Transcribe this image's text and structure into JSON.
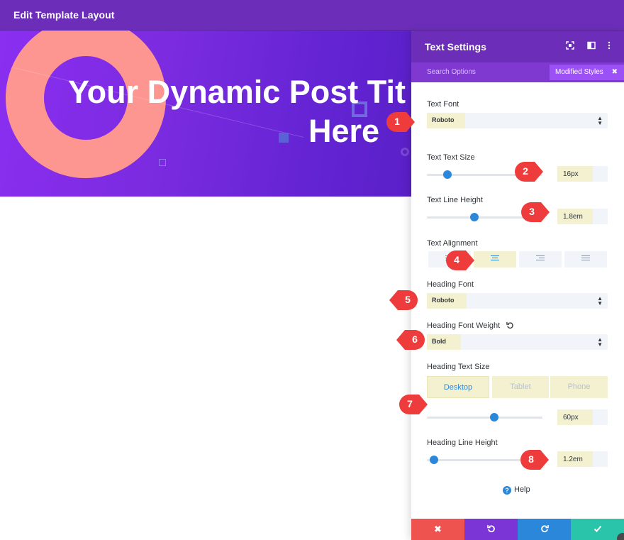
{
  "topbar": {
    "title": "Edit Template Layout"
  },
  "hero": {
    "title_line1": "Your Dynamic Post Tit",
    "title_line2": "Here"
  },
  "panel": {
    "title": "Text Settings",
    "header_icons": [
      "expand-icon",
      "sidebar-icon",
      "more-icon"
    ],
    "search_placeholder": "Search Options",
    "modified_label": "Modified Styles",
    "text_font": {
      "label": "Text Font",
      "value": "Roboto"
    },
    "text_size": {
      "label": "Text Text Size",
      "value": "16px",
      "level": 0.18
    },
    "text_line_height": {
      "label": "Text Line Height",
      "value": "1.8em",
      "level": 0.41
    },
    "text_alignment": {
      "label": "Text Alignment",
      "options": [
        "left",
        "center",
        "right",
        "justify"
      ],
      "selected": "center"
    },
    "heading_font": {
      "label": "Heading Font",
      "value": "Roboto"
    },
    "heading_font_weight": {
      "label": "Heading Font Weight",
      "value": "Bold"
    },
    "heading_text_size": {
      "label": "Heading Text Size",
      "tabs": [
        "Desktop",
        "Tablet",
        "Phone"
      ],
      "active_tab": "Desktop",
      "value": "60px",
      "level": 0.58
    },
    "heading_line_height": {
      "label": "Heading Line Height",
      "value": "1.2em",
      "level": 0.06
    },
    "help_label": "Help"
  },
  "markers": [
    "1",
    "2",
    "3",
    "4",
    "5",
    "6",
    "7",
    "8"
  ],
  "colors": {
    "purple_dark": "#6c2eb9",
    "accent_blue": "#2b87da",
    "marker_red": "#ee3b3b",
    "cancel": "#ef5350",
    "undo": "#7b34d6",
    "redo": "#2b87da",
    "save": "#29c4a9"
  }
}
